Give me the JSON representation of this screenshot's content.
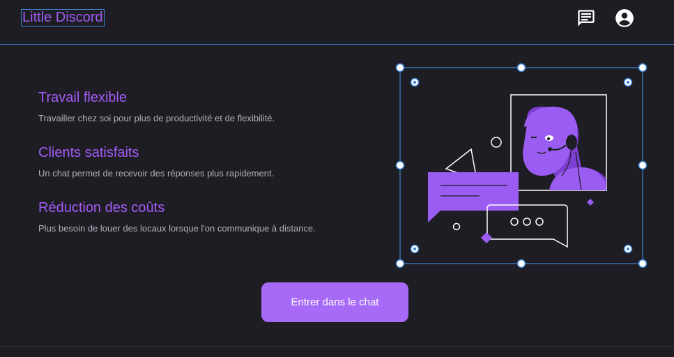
{
  "header": {
    "title": "Little Discord",
    "icons": {
      "chat": "chat-icon",
      "account": "account-circle-icon"
    }
  },
  "features": [
    {
      "title": "Travail flexible",
      "description": "Travailler chez soi pour plus de productivité et de flexibilité."
    },
    {
      "title": "Clients satisfaits",
      "description": "Un chat permet de recevoir des réponses plus rapidement."
    },
    {
      "title": "Réduction des coûts",
      "description": "Plus besoin de louer des locaux lorsque l'on communique à distance."
    }
  ],
  "cta": {
    "label": "Entrer dans le chat"
  },
  "colors": {
    "background": "#1e1d24",
    "accent": "#a35cf6",
    "button": "#a66af6",
    "selection": "#3f86d6",
    "text_muted": "#b2b1ba"
  }
}
